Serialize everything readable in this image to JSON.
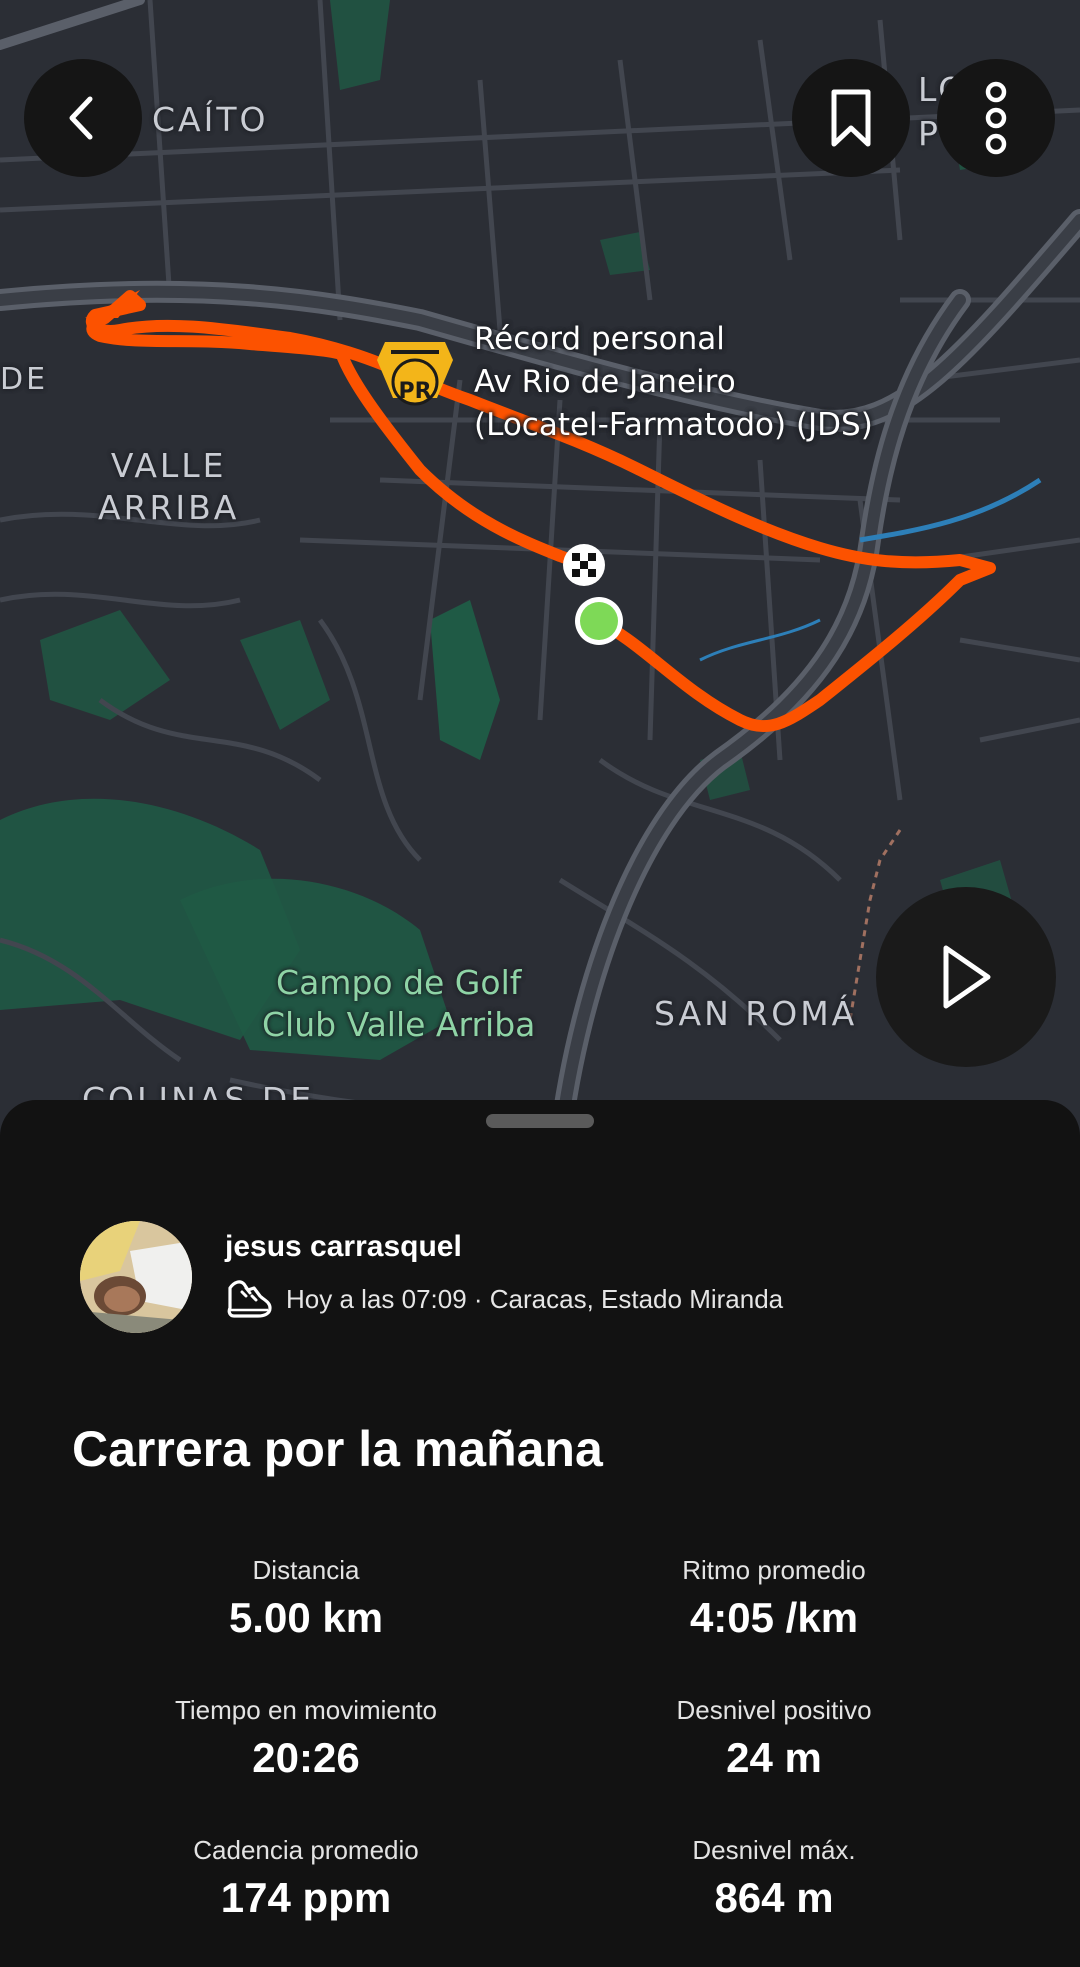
{
  "map": {
    "labels": {
      "caito": "CAÍTO",
      "de": "DE",
      "valle_arriba": [
        "VALLE",
        "ARRIBA"
      ],
      "golf": [
        "Campo de Golf",
        "Club Valle Arriba"
      ],
      "san_roman": "SAN ROMÁ",
      "colinas": "COLINAS DE",
      "lo_top": "LO",
      "p_top": "P"
    },
    "pr_badge": "PR",
    "pr_callout": [
      "Récord personal",
      "Av Rio de Janeiro",
      "(Locatel-Farmatodo) (JDS)"
    ],
    "route_color": "#fc5200",
    "start_color": "#7ed957"
  },
  "buttons": {
    "back": "back-icon",
    "bookmark": "bookmark-icon",
    "more": "more-vertical-icon",
    "play": "play-icon"
  },
  "activity": {
    "user_name": "jesus carrasquel",
    "meta": "Hoy a las 07:09 · Caracas, Estado Miranda",
    "sport_icon": "running-shoe-icon",
    "title": "Carrera por la mañana"
  },
  "stats": [
    {
      "label": "Distancia",
      "value": "5.00 km"
    },
    {
      "label": "Ritmo promedio",
      "value": "4:05 /km"
    },
    {
      "label": "Tiempo en movimiento",
      "value": "20:26"
    },
    {
      "label": "Desnivel positivo",
      "value": "24 m"
    },
    {
      "label": "Cadencia promedio",
      "value": "174 ppm"
    },
    {
      "label": "Desnivel máx.",
      "value": "864 m"
    }
  ]
}
